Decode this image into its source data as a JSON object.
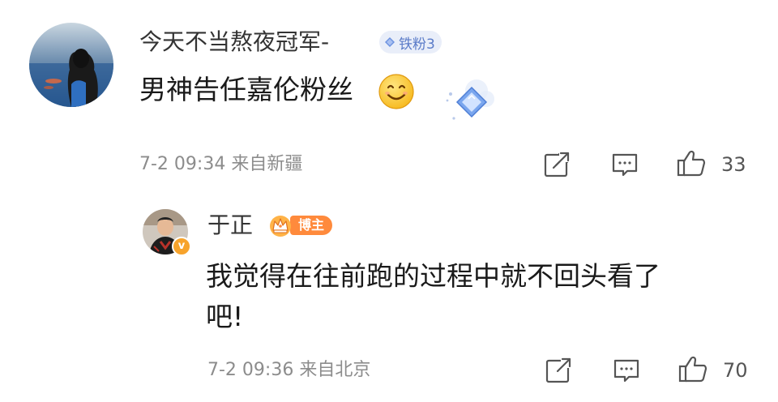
{
  "comment": {
    "username": "今天不当熬夜冠军-",
    "fan_badge": "铁粉3",
    "text": "男神告任嘉伦粉丝",
    "emoji": "smile-emoji",
    "date": "7-2 09:34",
    "location": "来自新疆",
    "likes": "33"
  },
  "reply": {
    "username": "于正",
    "badge": "博主",
    "verified_icon": "v",
    "text_line_1": "我觉得在往前跑的过程中就不回头看了",
    "text_line_2": "吧!",
    "date": "7-2 09:36",
    "location": "来自北京",
    "likes": "70"
  },
  "colors": {
    "fan_badge_bg": "#e9eef9",
    "fan_badge_text": "#5a7bc8",
    "blogger_badge": "#ff8a3c",
    "verified": "#f7a32b",
    "meta_text": "#8c8c8c",
    "icon_stroke": "#555555"
  },
  "icons": {
    "share": "share-icon",
    "comment": "comment-icon",
    "like": "thumbs-up-icon"
  }
}
